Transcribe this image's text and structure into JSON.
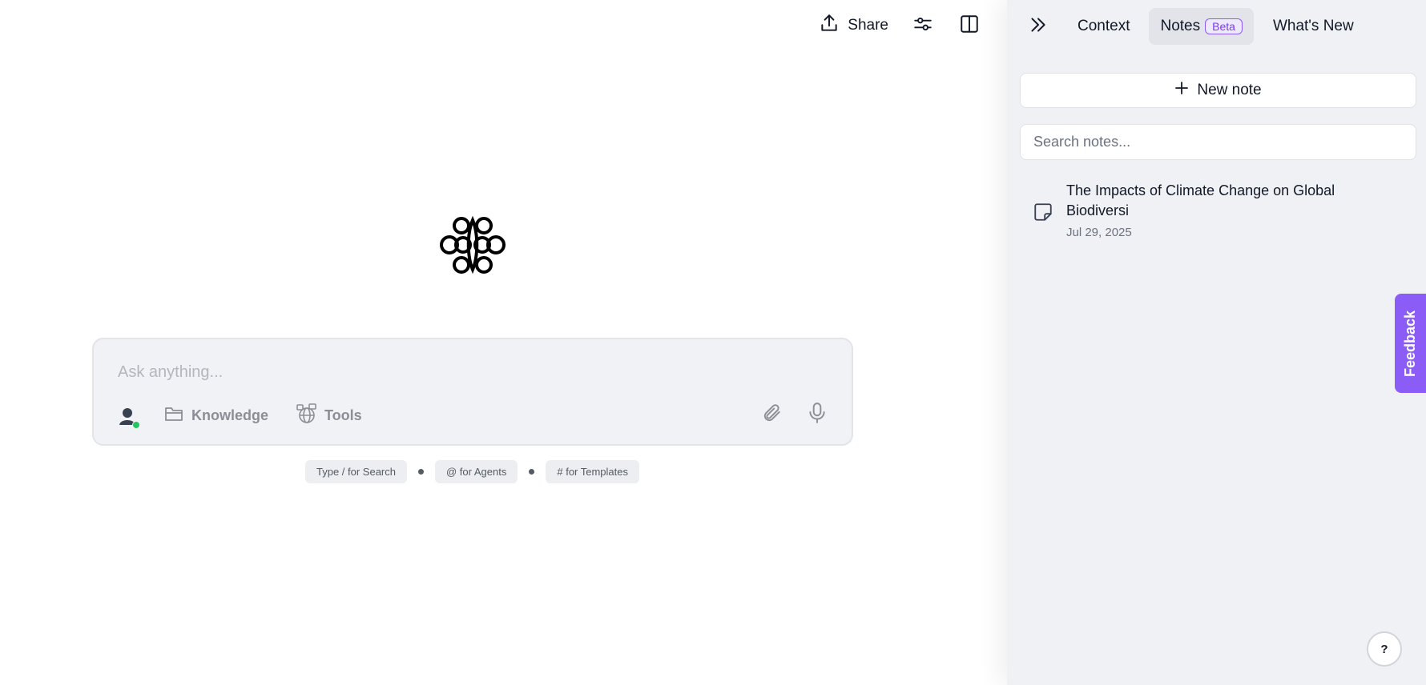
{
  "header": {
    "share_label": "Share"
  },
  "composer": {
    "placeholder": "Ask anything...",
    "knowledge_label": "Knowledge",
    "tools_label": "Tools"
  },
  "hints": {
    "search": "Type / for Search",
    "agents": "@ for Agents",
    "templates": "# for Templates"
  },
  "panel": {
    "tabs": [
      {
        "label": "Context"
      },
      {
        "label": "Notes",
        "badge": "Beta"
      },
      {
        "label": "What's New"
      }
    ],
    "active_tab": "Notes",
    "new_note_label": "New note",
    "search_placeholder": "Search notes...",
    "notes": [
      {
        "title": "The Impacts of Climate Change on Global Biodiversi",
        "date": "Jul 29, 2025"
      }
    ]
  },
  "feedback_label": "Feedback",
  "help_label": "?",
  "colors": {
    "accent": "#8b5cf6",
    "online": "#22c55e",
    "panel_bg": "#f0f1f5"
  }
}
